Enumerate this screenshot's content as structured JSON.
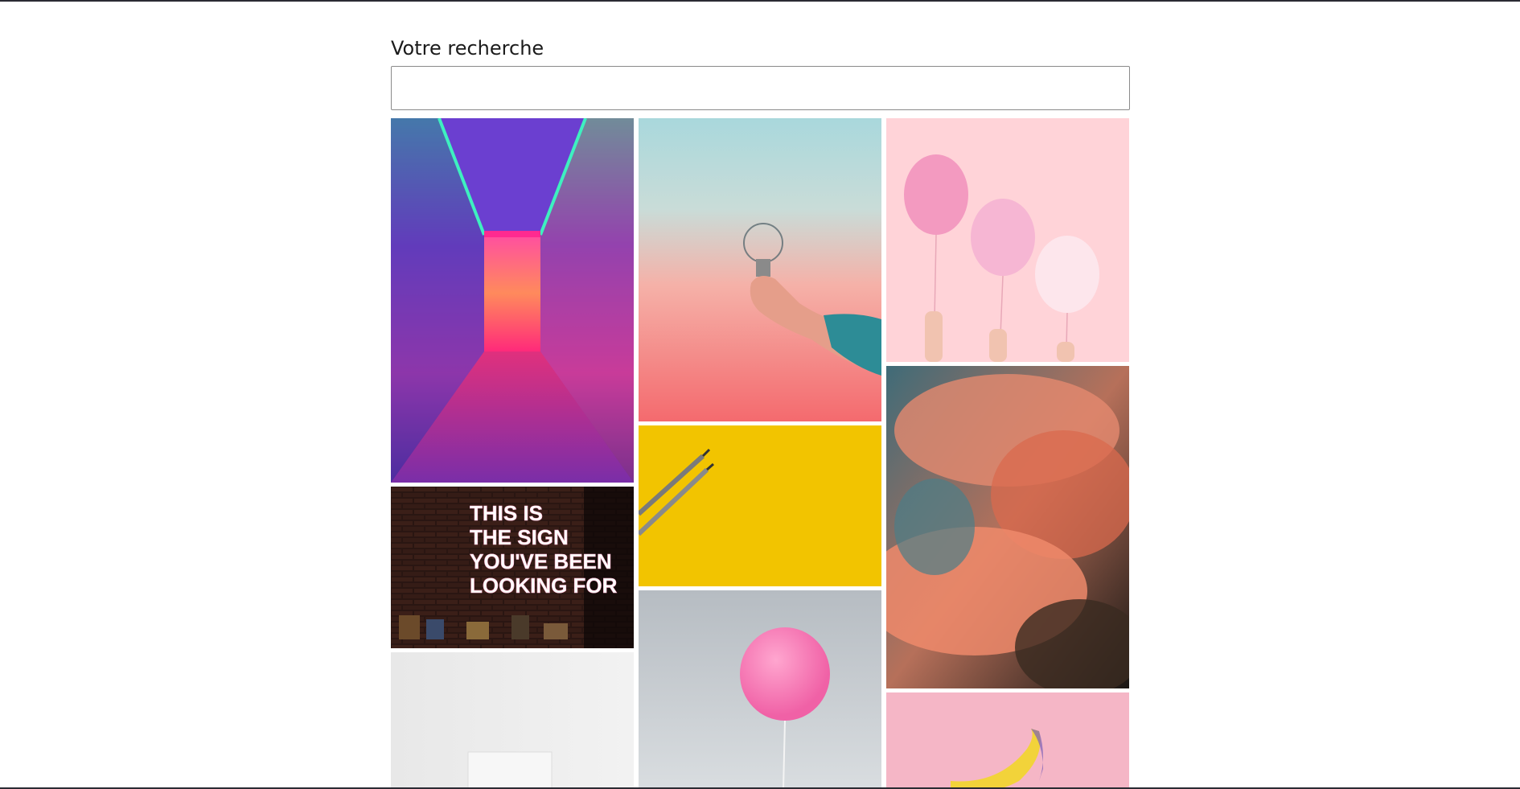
{
  "search": {
    "label": "Votre recherche",
    "value": "",
    "placeholder": ""
  },
  "gallery": {
    "sign_text": [
      "THIS IS",
      "THE SIGN",
      "YOU'VE BEEN",
      "LOOKING FOR"
    ]
  },
  "colors": {
    "page_background": "#ffffff",
    "frame_border": "#2b2b33",
    "input_border": "#8a8a8a"
  }
}
